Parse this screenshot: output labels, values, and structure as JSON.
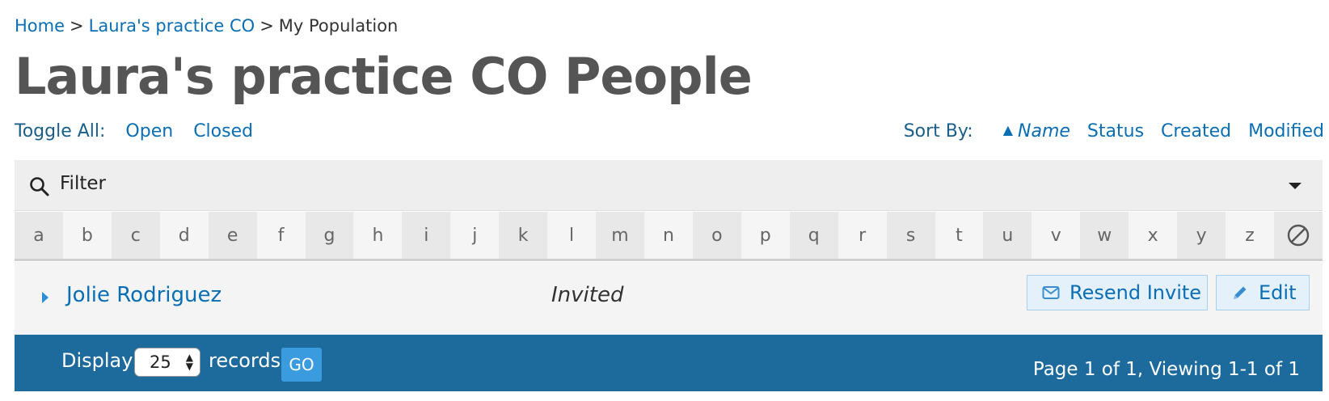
{
  "breadcrumb": {
    "items": [
      "Home",
      "Laura's practice CO"
    ],
    "current": "My Population",
    "separator": ">"
  },
  "page": {
    "title": "Laura's practice CO People"
  },
  "toggle": {
    "label": "Toggle All:",
    "open": "Open",
    "closed": "Closed"
  },
  "sort": {
    "label": "Sort By:",
    "active": "Name",
    "active_indicator": "▲",
    "options": [
      "Status",
      "Created",
      "Modified"
    ]
  },
  "filter": {
    "label": "Filter",
    "icon": "search-icon",
    "dropdown_icon": "caret-down-icon"
  },
  "alphabet": {
    "letters": [
      "a",
      "b",
      "c",
      "d",
      "e",
      "f",
      "g",
      "h",
      "i",
      "j",
      "k",
      "l",
      "m",
      "n",
      "o",
      "p",
      "q",
      "r",
      "s",
      "t",
      "u",
      "v",
      "w",
      "x",
      "y",
      "z"
    ],
    "clear_icon": "no-symbol-icon"
  },
  "people": [
    {
      "name": "Jolie Rodriguez",
      "status": "Invited",
      "resend_label": "Resend Invite",
      "edit_label": "Edit"
    }
  ],
  "footer": {
    "display_label": "Display",
    "records_per_page": "25",
    "records_label": "records",
    "go_label": "GO",
    "page_info": "Page 1 of 1, Viewing 1-1 of 1"
  },
  "colors": {
    "link": "#0a6eb4",
    "footer_bg": "#1d6a9c",
    "go_button": "#3a9cde",
    "title": "#555555"
  }
}
